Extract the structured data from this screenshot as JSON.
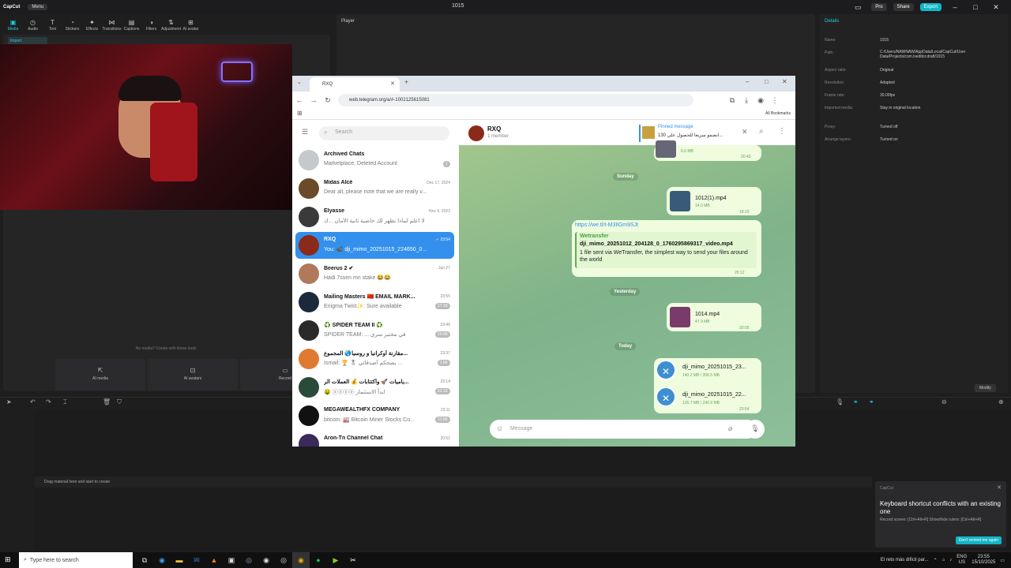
{
  "app": {
    "logo": "CapCut",
    "menu": "Menu",
    "title": "1015",
    "pro": "Pro",
    "share": "Share",
    "export": "Export"
  },
  "toolbar": [
    "Media",
    "Audio",
    "Text",
    "Stickers",
    "Effects",
    "Transitions",
    "Captions",
    "Filters",
    "Adjustment",
    "AI avatar"
  ],
  "media": {
    "import": "Import",
    "no_media": "No media? Create with these tools",
    "ai_media": "AI media",
    "ai_avatars": "AI avatars",
    "record": "Record"
  },
  "player": {
    "title": "Player"
  },
  "details": {
    "title": "Details",
    "rows": [
      {
        "label": "Name:",
        "value": "1015"
      },
      {
        "label": "Path:",
        "value": "C:/Users/NAWNAW/AppData/Local/CapCut/User Data/Projects/com.lveditor.draft/1015"
      },
      {
        "label": "Aspect ratio:",
        "value": "Original"
      },
      {
        "label": "Resolution:",
        "value": "Adapted"
      },
      {
        "label": "Frame rate:",
        "value": "30.00fps"
      },
      {
        "label": "Imported media:",
        "value": "Stay in original location"
      },
      {
        "label": "Proxy:",
        "value": "Turned off"
      },
      {
        "label": "Arrange layers:",
        "value": "Turned on"
      }
    ],
    "modify": "Modify"
  },
  "timeline": {
    "drag_hint": "Drag material here and start to create"
  },
  "toast": {
    "app": "CapCut",
    "title": "Keyboard shortcut conflicts with an existing one",
    "sub": "Record screen: [Ctrl+Alt+R]  Show/hide rulers: [Ctrl+Alt+R]",
    "button": "Don't remind me again"
  },
  "taskbar": {
    "search": "Type here to search",
    "notice": "El reto más difícil par...",
    "lang": "ENG",
    "region": "US",
    "time": "23:55",
    "date": "15/10/2025"
  },
  "browser": {
    "tab_title": "RXQ",
    "url": "web.telegram.org/a/#-1002125615081",
    "bookmarks": "All Bookmarks"
  },
  "telegram": {
    "search_placeholder": "Search",
    "chats": [
      {
        "name": "Archived Chats",
        "msg": "Marketplace, Deleted Account",
        "time": "",
        "badge": "1",
        "color": "#c4c9cc"
      },
      {
        "name": "Midas Alcé",
        "msg": "Dear all, please note that we are really v...",
        "time": "Dec 17, 2024",
        "badge": "",
        "color": "#6b4a2a"
      },
      {
        "name": "Elyasse",
        "msg": "لا اعلم لماذا نظهر لك خاصية ثانية الأمان ...ك",
        "time": "Nov 9, 2023",
        "badge": "",
        "color": "#3a3a3a"
      },
      {
        "name": "RXQ",
        "msg": "You: 📹 dji_mimo_20251015_224650_0...",
        "time": "✓ 23:54",
        "badge": "",
        "color": "#8a2a1a"
      },
      {
        "name": "Beerus 2 ✔",
        "msg": "Hadi 7ssen mn stake 😂😂",
        "time": "Jun 27",
        "badge": "",
        "color": "#b07a5a"
      },
      {
        "name": "Mailing Masters 🇨🇳 EMAIL MARK...",
        "msg": "Enigma Twist✨: Sure available",
        "time": "23:55",
        "badge": "17.1K",
        "color": "#1a2a3a"
      },
      {
        "name": "♻️ SPIDER TEAM II ♻️",
        "msg": "SPIDER TEAM: ... في مختبر سري",
        "time": "23:46",
        "badge": "10.9K",
        "color": "#2a2a2a"
      },
      {
        "name": "مقارنة أوكرانيا و روسيا🌏 المجموع...",
        "msg": "Ismail: 🏆 🎖 يصحكم أصدقائي ...",
        "time": "23:37",
        "badge": "1.6K",
        "color": "#e07a30"
      },
      {
        "name": "ياميات 🚀 وأكتتابات 💰 العملات الر...",
        "msg": "🤑 ⓞⓞⓞⓞ ابدأ الاستثمار",
        "time": "23:14",
        "badge": "33.1K",
        "color": "#2a4a3a"
      },
      {
        "name": "MEGAWEALTHFX COMPANY",
        "msg": "bitcoin: 🏭 Bitcoin Miner Stocks Co...",
        "time": "23:11",
        "badge": "11.6K",
        "color": "#111"
      },
      {
        "name": "Aron-Tn Channel Chat",
        "msg": "",
        "time": "20:52",
        "badge": "",
        "color": "#3a2a5a"
      }
    ],
    "header": {
      "name": "RXQ",
      "members": "1 member",
      "pinned_title": "Pinned message",
      "pinned_text": "انضمو سريعا للحصول علي 130..."
    },
    "messages": {
      "top_size": "6.6 MB",
      "top_time": "20:43",
      "day1": "Sunday",
      "f1_name": "1012(1).mp4",
      "f1_size": "14.0 MB",
      "f1_time": "18:15",
      "link": "https://we.tl/t-M3IlGm9SJt",
      "wt_title": "Wetransfer",
      "wt_file": "dji_mimo_20251012_204128_0_1760295869317_video.mp4",
      "wt_desc": "1 file sent via WeTransfer, the simplest way to send your files around the world",
      "wt_time": "20:12",
      "day2": "Yesterday",
      "f2_name": "1014.mp4",
      "f2_size": "47.9 MB",
      "f2_time": "20:05",
      "day3": "Today",
      "f3_name": "dji_mimo_20251015_23...",
      "f3_size": "140.2 MB / 356.5 MB",
      "f4_name": "dji_mimo_20251015_22...",
      "f4_size": "126.7 MB / 240.9 MB",
      "f4_time": "23:54"
    },
    "input_placeholder": "Message"
  }
}
